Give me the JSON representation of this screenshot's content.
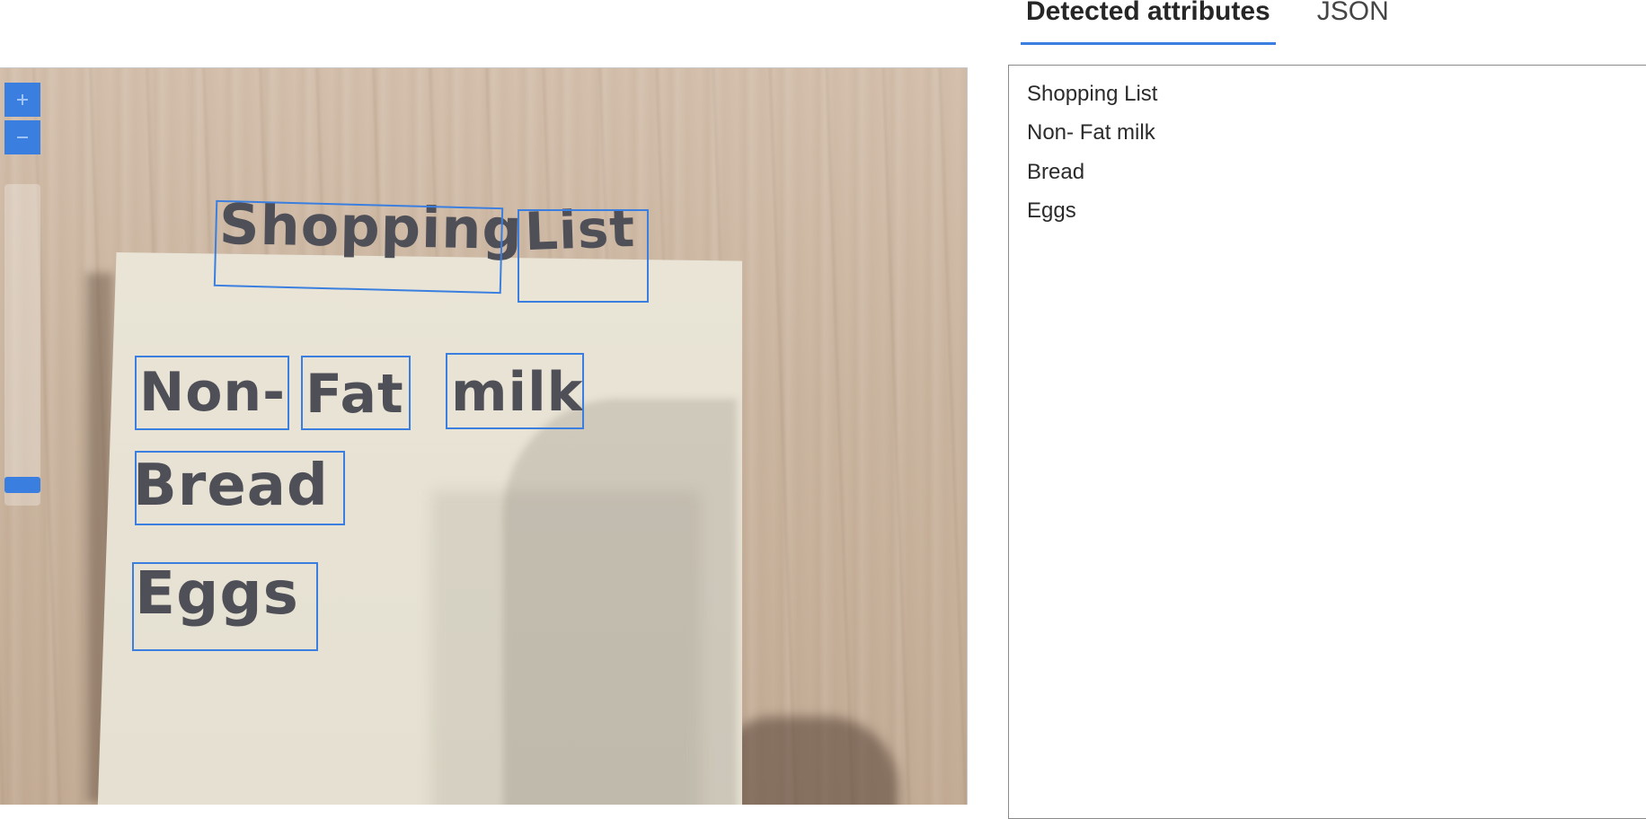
{
  "tabs": [
    {
      "label": "Detected attributes",
      "active": true
    },
    {
      "label": "JSON",
      "active": false
    }
  ],
  "viewer": {
    "zoom_in_icon": "plus-icon",
    "zoom_out_icon": "minus-icon",
    "handwriting": {
      "shopping": "Shopping",
      "list": "List",
      "non": "Non-",
      "fat": "Fat",
      "milk": "milk",
      "bread": "Bread",
      "eggs": "Eggs"
    }
  },
  "results": {
    "lines": [
      "Shopping List",
      "Non- Fat milk",
      "Bread",
      "Eggs"
    ]
  },
  "colors": {
    "accent": "#3a7fe0",
    "text": "#2b2b2b"
  }
}
